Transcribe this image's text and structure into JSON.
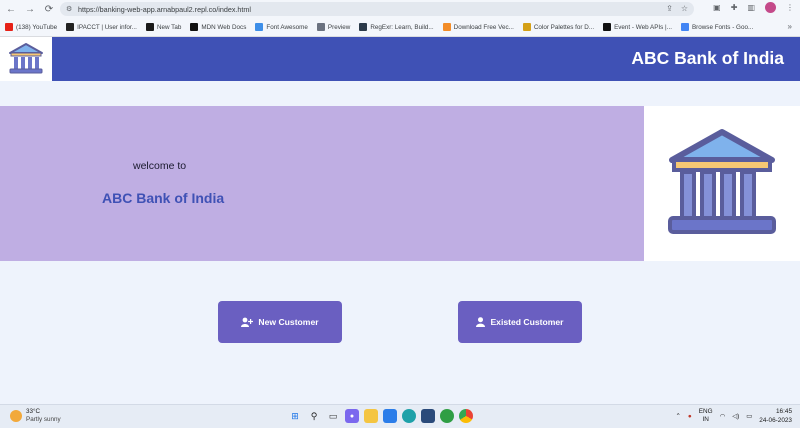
{
  "browser": {
    "url": "https://banking-web-app.arnabpaul2.repl.co/index.html",
    "bookmarks": [
      {
        "label": "(138) YouTube",
        "color": "#e62117"
      },
      {
        "label": "IPACCT | User infor...",
        "color": "#222222"
      },
      {
        "label": "New Tab",
        "color": "#1a1a1a"
      },
      {
        "label": "MDN Web Docs",
        "color": "#111111"
      },
      {
        "label": "Font Awesome",
        "color": "#3d8ee8"
      },
      {
        "label": "Preview",
        "color": "#6b7280"
      },
      {
        "label": "RegExr: Learn, Build...",
        "color": "#2b3a4a"
      },
      {
        "label": "Download Free Vec...",
        "color": "#f28c28"
      },
      {
        "label": "Color Palettes for D...",
        "color": "#d4a017"
      },
      {
        "label": "Event - Web APIs |...",
        "color": "#111111"
      },
      {
        "label": "Browse Fonts - Goo...",
        "color": "#4285f4"
      }
    ]
  },
  "header": {
    "brand": "ABC Bank of India",
    "bar_color": "#3f51b5"
  },
  "hero": {
    "welcome": "welcome to",
    "bank_name": "ABC Bank of India",
    "background": "#bfaee3"
  },
  "actions": {
    "new_customer": {
      "label": "New Customer",
      "icon": "user-plus-icon"
    },
    "existed_customer": {
      "label": "Existed Customer",
      "icon": "user-icon"
    },
    "button_color": "#6a5fc1"
  },
  "taskbar": {
    "weather_temp": "33°C",
    "weather_desc": "Partly sunny",
    "language": "ENG",
    "region": "IN",
    "time": "16:45",
    "date": "24-06-2023"
  }
}
